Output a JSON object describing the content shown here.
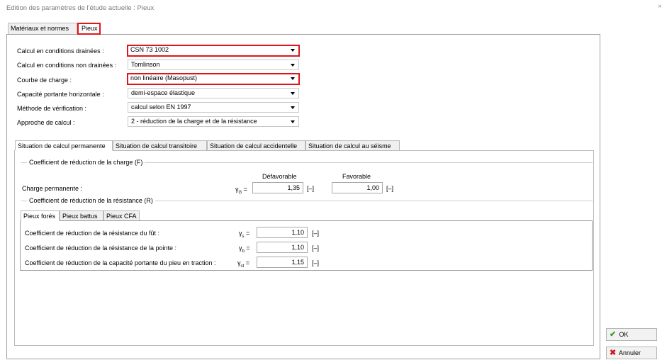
{
  "window": {
    "title": "Edition des paramètres de l'étude actuelle : Pieux",
    "close_glyph": "×"
  },
  "top_tabs": [
    {
      "label": "Matériaux et normes"
    },
    {
      "label": "Pieux",
      "active": true,
      "highlight_color": "#e0141b"
    }
  ],
  "form": {
    "rows": [
      {
        "label": "Calcul en conditions drainées :",
        "value": "CSN 73 1002",
        "highlighted": true
      },
      {
        "label": "Calcul en conditions non drainées :",
        "value": "Tomlinson"
      },
      {
        "label": "Courbe de charge :",
        "value": "non linéaire (Masopust)",
        "highlighted": true
      },
      {
        "label": "Capacité portante horizontale :",
        "value": "demi-espace élastique"
      },
      {
        "label": "Méthode de vérification :",
        "value": "calcul selon EN 1997"
      },
      {
        "label": "Approche de calcul :",
        "value": "2 - réduction de la charge et de la résistance"
      }
    ]
  },
  "situation_tabs": [
    {
      "label": "Situation de calcul permanente",
      "active": true
    },
    {
      "label": "Situation de calcul transitoire"
    },
    {
      "label": "Situation de calcul accidentelle"
    },
    {
      "label": "Situation de calcul au séisme"
    }
  ],
  "load_group": {
    "title": "Coefficient de réduction de la charge (F)",
    "col_unfavorable": "Défavorable",
    "col_favorable": "Favorable",
    "row_label": "Charge permanente :",
    "symbol": "γ",
    "symbol_sub": "G",
    "eq": "=",
    "unfavorable_value": "1,35",
    "favorable_value": "1,00",
    "unit": "[–]"
  },
  "resistance_group": {
    "title": "Coefficient de réduction de la résistance (R)",
    "pile_tabs": [
      {
        "label": "Pieux forés",
        "active": true
      },
      {
        "label": "Pieux battus"
      },
      {
        "label": "Pieux CFA"
      }
    ],
    "rows": [
      {
        "label": "Coefficient de réduction de la résistance du fût :",
        "symbol": "γ",
        "sub": "s",
        "value": "1,10",
        "unit": "[–]"
      },
      {
        "label": "Coefficient de réduction de la résistance de la pointe :",
        "symbol": "γ",
        "sub": "b",
        "value": "1,10",
        "unit": "[–]"
      },
      {
        "label": "Coefficient de réduction de la capacité portante du pieu en traction :",
        "symbol": "γ",
        "sub": "st",
        "value": "1,15",
        "unit": "[–]"
      }
    ],
    "eq": "="
  },
  "buttons": {
    "ok": {
      "label": "OK",
      "icon": "check-icon",
      "color": "#3a9a2a"
    },
    "cancel": {
      "label": "Annuler",
      "icon": "cross-icon",
      "color": "#d01a1a"
    }
  }
}
